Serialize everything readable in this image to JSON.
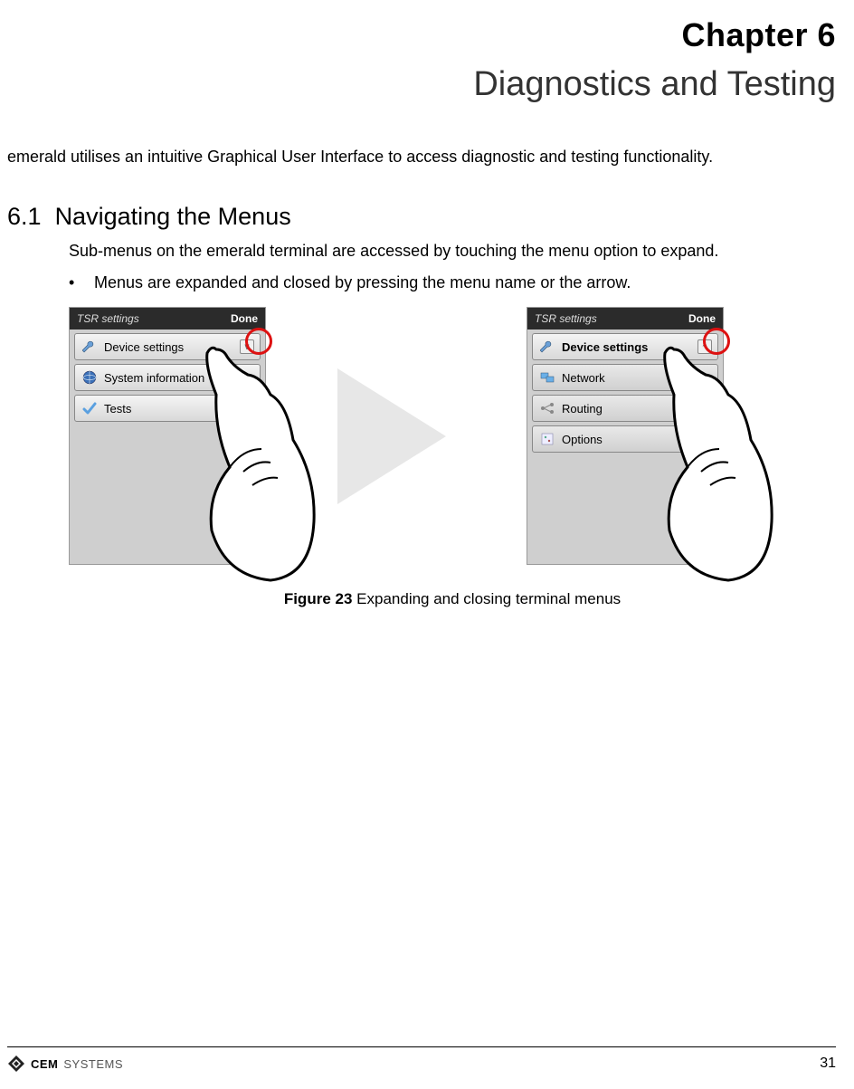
{
  "chapter": {
    "number": "Chapter 6",
    "title": "Diagnostics and Testing"
  },
  "intro": "emerald utilises an intuitive Graphical User Interface to access diagnostic and testing functionality.",
  "section": {
    "number": "6.1",
    "title": "Navigating the Menus",
    "desc": "Sub-menus on the emerald terminal are accessed by touching the menu option to expand.",
    "bullet": "Menus are expanded and closed by pressing the menu name or the arrow."
  },
  "figure": {
    "label": "Figure 23",
    "caption": "Expanding and closing terminal menus"
  },
  "panel_left": {
    "header": "TSR settings",
    "done": "Done",
    "items": [
      {
        "label": "Device settings",
        "chev": "v"
      },
      {
        "label": "System information",
        "chev": ""
      },
      {
        "label": "Tests",
        "chev": "v"
      }
    ]
  },
  "panel_right": {
    "header": "TSR settings",
    "done": "Done",
    "items": [
      {
        "label": "Device settings",
        "chev": "^",
        "bold": true
      },
      {
        "label": "Network",
        "chev": ""
      },
      {
        "label": "Routing",
        "chev": "v"
      },
      {
        "label": "Options",
        "chev": "v"
      }
    ]
  },
  "footer": {
    "brand1": "CEM",
    "brand2": "SYSTEMS",
    "page": "31"
  }
}
